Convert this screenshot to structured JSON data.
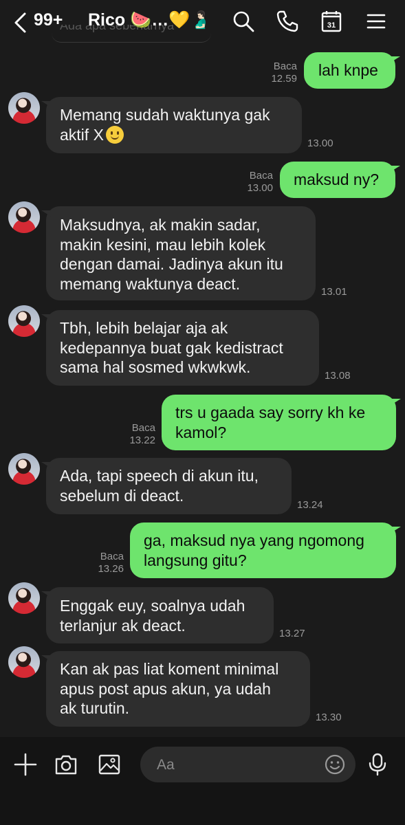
{
  "header": {
    "unread_count": "99+",
    "contact_name": "Rico 🍉…💛🫃🏻",
    "calendar_day": "31",
    "ghost_text": "Ada apa sebenarnya"
  },
  "messages": [
    {
      "from": "me",
      "text": "lah knpe",
      "status": "Baca",
      "time": "12.59"
    },
    {
      "from": "them",
      "text": "Memang sudah waktunya gak\naktif X",
      "emoji": "slightly-smiling-face",
      "time": "13.00"
    },
    {
      "from": "me",
      "text": "maksud ny?",
      "status": "Baca",
      "time": "13.00"
    },
    {
      "from": "them",
      "text": "Maksudnya, ak makin sadar,\nmakin kesini, mau lebih kolek\ndengan damai. Jadinya akun itu\nmemang waktunya deact.",
      "time": "13.01"
    },
    {
      "from": "them",
      "text": "Tbh, lebih belajar aja ak\nkedepannya buat gak kedistract\nsama hal sosmed wkwkwk.",
      "time": "13.08"
    },
    {
      "from": "me",
      "text": "trs u gaada say sorry kh ke\nkamol?",
      "status": "Baca",
      "time": "13.22"
    },
    {
      "from": "them",
      "text": "Ada, tapi speech di akun itu,\nsebelum di deact.",
      "time": "13.24"
    },
    {
      "from": "me",
      "text": "ga, maksud nya yang ngomong\nlangsung gitu?",
      "status": "Baca",
      "time": "13.26"
    },
    {
      "from": "them",
      "text": "Enggak euy, soalnya udah\nterlanjur ak deact.",
      "time": "13.27"
    },
    {
      "from": "them",
      "text": "Kan ak pas liat koment minimal\napus post apus akun, ya udah\nak turutin.",
      "time": "13.30"
    }
  ],
  "composer": {
    "placeholder": "Aa"
  },
  "colors": {
    "background": "#1b1b1b",
    "incoming_bubble": "#2e2e2e",
    "outgoing_bubble": "#6ee46d",
    "meta_text": "#9a9a9a"
  }
}
